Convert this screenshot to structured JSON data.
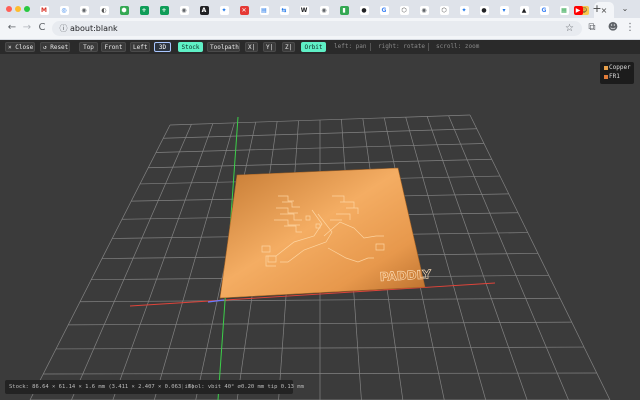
{
  "browser": {
    "tab_icons": [
      {
        "name": "gmail-icon",
        "glyph": "M",
        "bg": "#ffffff",
        "fg": "#d93025"
      },
      {
        "name": "extension-icon",
        "glyph": "◎",
        "bg": "#ffffff",
        "fg": "#1a73e8"
      },
      {
        "name": "globe-icon",
        "glyph": "◉",
        "bg": "#ffffff",
        "fg": "#5f6368"
      },
      {
        "name": "circle-icon",
        "glyph": "◐",
        "bg": "#ffffff",
        "fg": "#555"
      },
      {
        "name": "shield-icon",
        "glyph": "⬢",
        "bg": "#34a853",
        "fg": "#ffffff"
      },
      {
        "name": "sheets-icon",
        "glyph": "+",
        "bg": "#0f9d58",
        "fg": "#ffffff"
      },
      {
        "name": "sheets-icon",
        "glyph": "+",
        "bg": "#0f9d58",
        "fg": "#ffffff"
      },
      {
        "name": "globe-icon",
        "glyph": "◉",
        "bg": "#ffffff",
        "fg": "#5f6368"
      },
      {
        "name": "notion-icon",
        "glyph": "A",
        "bg": "#202124",
        "fg": "#ffffff"
      },
      {
        "name": "spark-icon",
        "glyph": "✦",
        "bg": "#ffffff",
        "fg": "#1a73e8"
      },
      {
        "name": "stop-icon",
        "glyph": "✕",
        "bg": "#e53935",
        "fg": "#ffffff"
      },
      {
        "name": "doc-icon",
        "glyph": "▤",
        "bg": "#ffffff",
        "fg": "#1a73e8"
      },
      {
        "name": "translate-icon",
        "glyph": "⇆",
        "bg": "#ffffff",
        "fg": "#1a73e8"
      },
      {
        "name": "wikipedia-icon",
        "glyph": "W",
        "bg": "#ffffff",
        "fg": "#202124"
      },
      {
        "name": "globe-icon",
        "glyph": "◉",
        "bg": "#ffffff",
        "fg": "#5f6368"
      },
      {
        "name": "docs-icon",
        "glyph": "▮",
        "bg": "#34a853",
        "fg": "#ffffff"
      },
      {
        "name": "github-icon",
        "glyph": "●",
        "bg": "#ffffff",
        "fg": "#202124"
      },
      {
        "name": "google-icon",
        "glyph": "G",
        "bg": "#ffffff",
        "fg": "#4285f4"
      },
      {
        "name": "hex-icon",
        "glyph": "⬡",
        "bg": "#ffffff",
        "fg": "#2a2a2a"
      },
      {
        "name": "globe-icon",
        "glyph": "◉",
        "bg": "#ffffff",
        "fg": "#5f6368"
      },
      {
        "name": "hex-icon",
        "glyph": "⬡",
        "bg": "#ffffff",
        "fg": "#2a2a2a"
      },
      {
        "name": "spark-icon",
        "glyph": "✦",
        "bg": "#ffffff",
        "fg": "#1a73e8"
      },
      {
        "name": "github-icon",
        "glyph": "●",
        "bg": "#ffffff",
        "fg": "#202124"
      },
      {
        "name": "bookmark-icon",
        "glyph": "▾",
        "bg": "#ffffff",
        "fg": "#1a73e8"
      },
      {
        "name": "graduation-icon",
        "glyph": "▲",
        "bg": "#ffffff",
        "fg": "#202124"
      },
      {
        "name": "google-icon",
        "glyph": "G",
        "bg": "#ffffff",
        "fg": "#4285f4"
      },
      {
        "name": "grid-icon",
        "glyph": "▦",
        "bg": "#ffffff",
        "fg": "#34a853"
      },
      {
        "name": "emoji-icon",
        "glyph": "☺",
        "bg": "#f9c74f",
        "fg": "#202124"
      }
    ],
    "active_tab_close": "×",
    "youtube_icon": "▶",
    "new_tab": "+",
    "tab_menu": "⌄",
    "address": "about:blank",
    "nav_back": "←",
    "nav_forward": "→",
    "nav_reload": "C",
    "star": "☆",
    "extensions": "⧉",
    "profile": "☻",
    "menu": "⋮"
  },
  "toolbar": {
    "close": "× Close",
    "reset": "↺ Reset",
    "view_top": "Top",
    "view_front": "Front",
    "view_left": "Left",
    "view_3d": "3D",
    "stock": "Stock",
    "toolpath": "Toolpath",
    "axis_x": "X|",
    "axis_y": "Y|",
    "axis_z": "Z|",
    "orbit": "Orbit",
    "hint_pan": "left: pan",
    "hint_rotate": "right: rotate",
    "hint_zoom": "scroll: zoom"
  },
  "legend": {
    "copper": "Copper",
    "fr1": "FR1",
    "copper_color": "#e8a04a",
    "fr1_color": "#e07b39"
  },
  "board": {
    "label": "PADDLY",
    "copper_color": "#f2a65a"
  },
  "status": {
    "stock": "Stock: 86.64 × 61.14 × 1.6 mm (3.411 × 2.407 × 0.063 in)",
    "tool": "Tool: vbit 40° ⌀0.20 mm tip 0.13 mm"
  }
}
